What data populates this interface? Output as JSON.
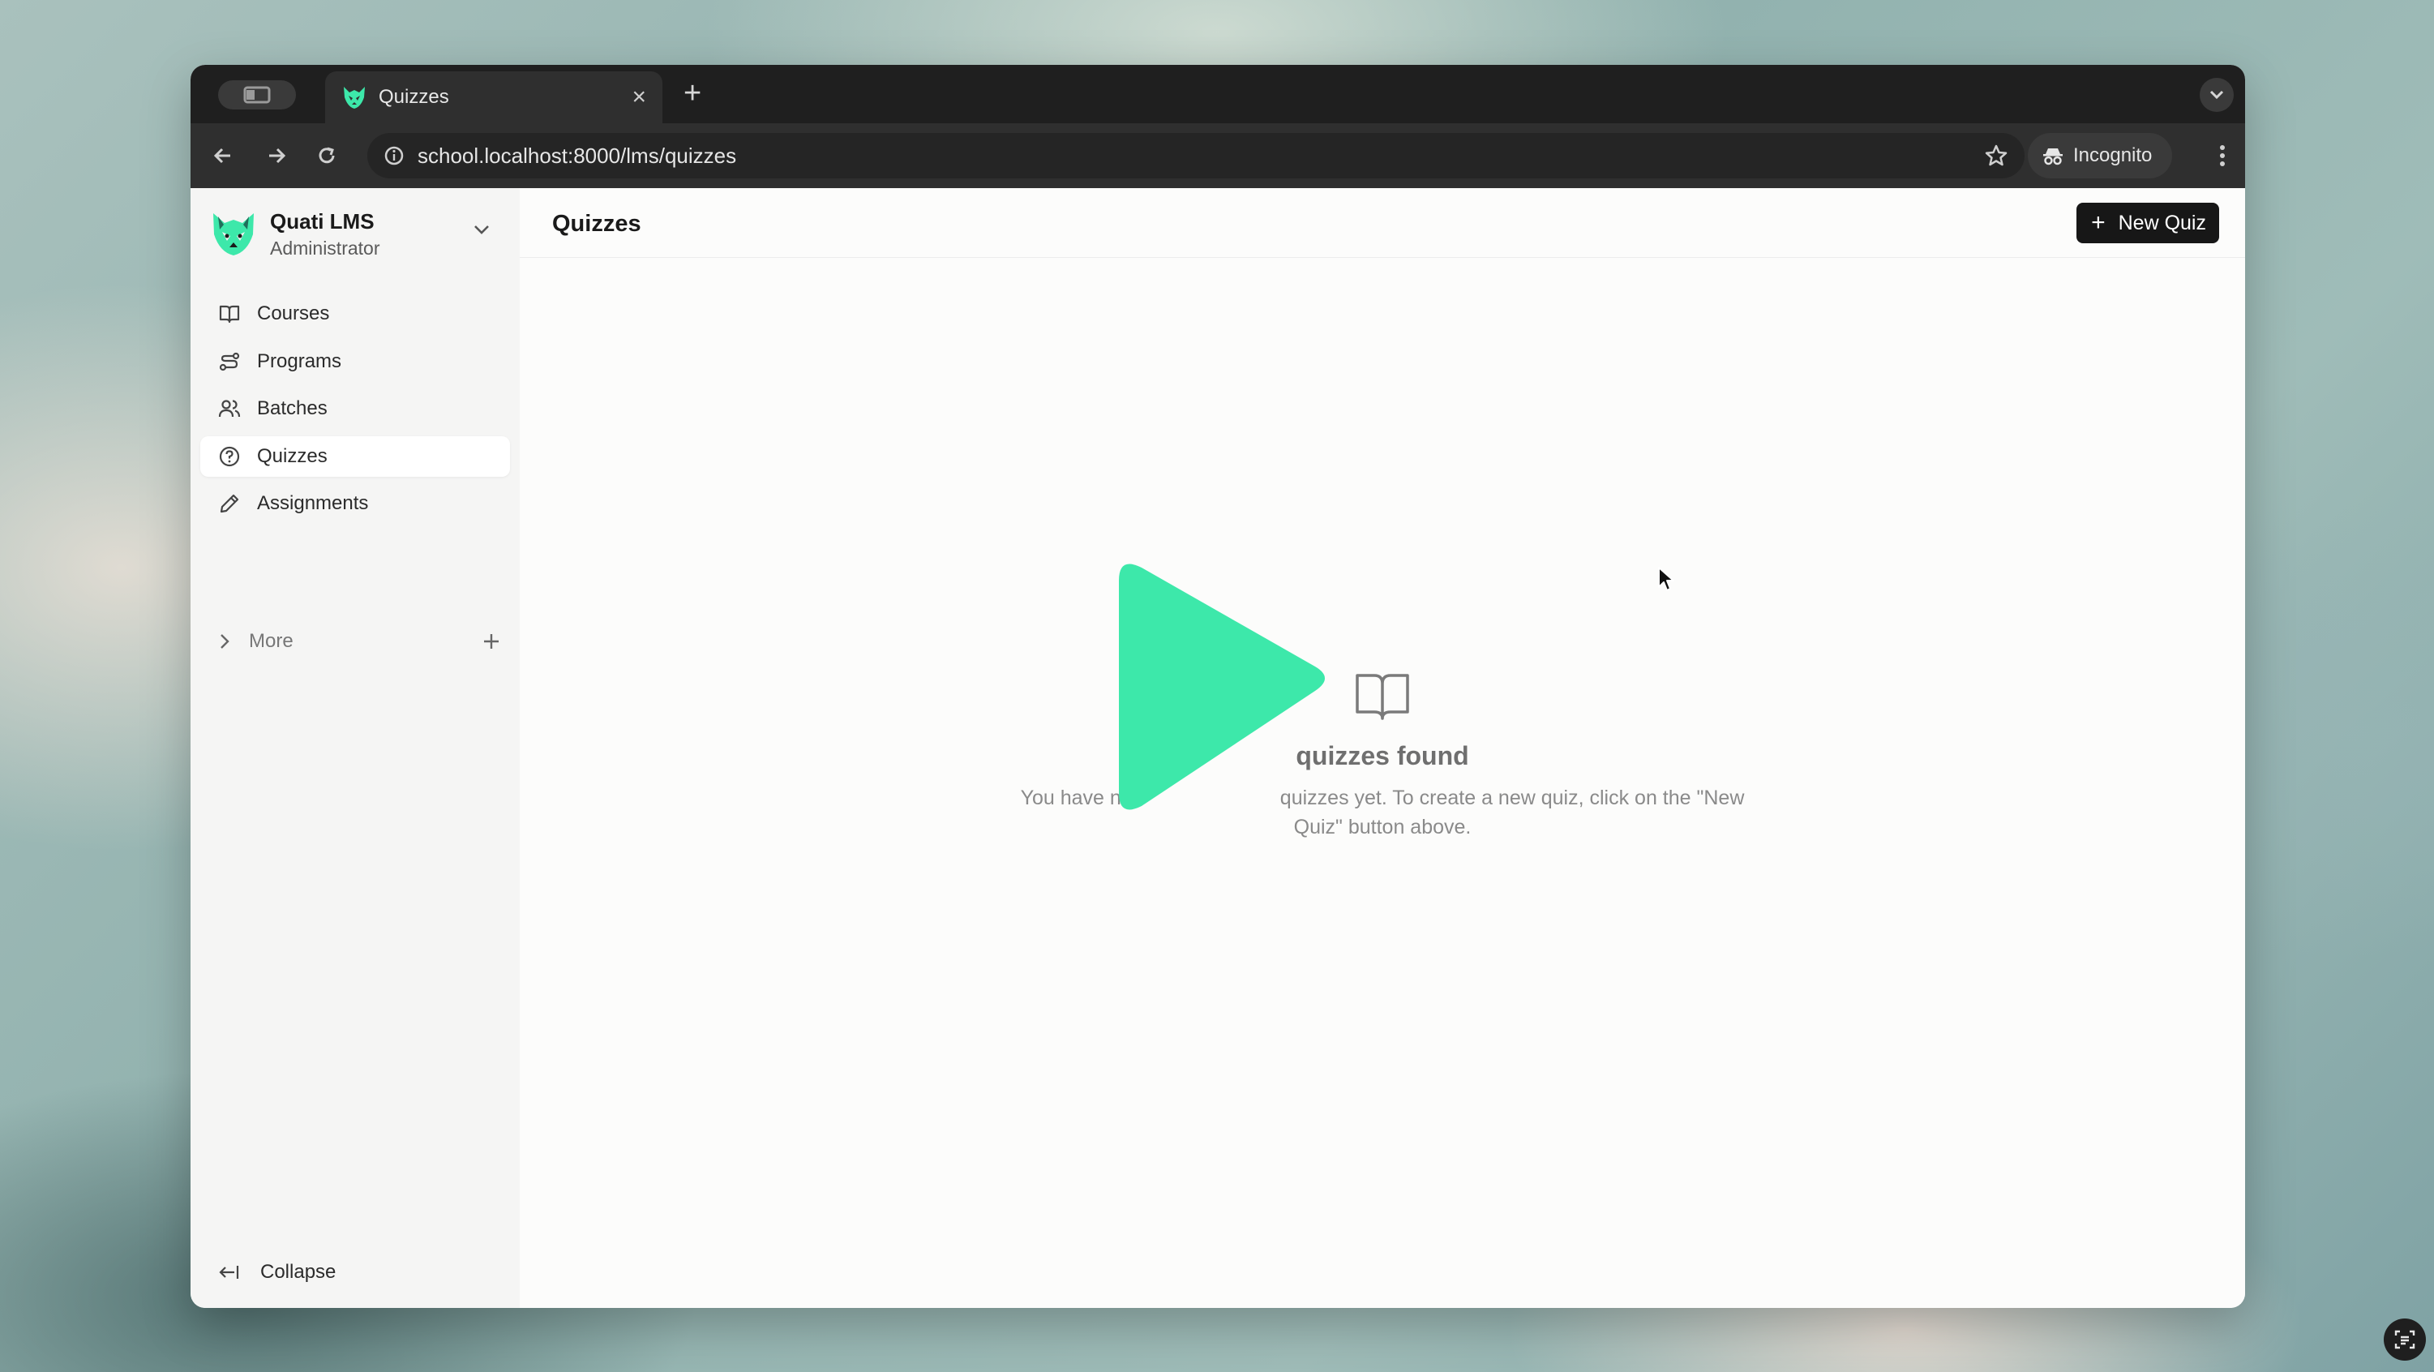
{
  "browser": {
    "tab_title": "Quizzes",
    "url": "school.localhost:8000/lms/quizzes",
    "incognito_label": "Incognito"
  },
  "sidebar": {
    "brand_name": "Quati LMS",
    "brand_role": "Administrator",
    "items": [
      {
        "label": "Courses",
        "icon": "book-open-icon"
      },
      {
        "label": "Programs",
        "icon": "route-icon"
      },
      {
        "label": "Batches",
        "icon": "users-icon"
      },
      {
        "label": "Quizzes",
        "icon": "help-circle-icon",
        "active": true
      },
      {
        "label": "Assignments",
        "icon": "pencil-icon"
      }
    ],
    "more_label": "More",
    "collapse_label": "Collapse"
  },
  "main": {
    "title": "Quizzes",
    "new_button_label": "New Quiz",
    "empty_title": "quizzes found",
    "empty_desc_left": "You have n",
    "empty_desc_right": "quizzes yet. To create a new quiz, click on the \"New Quiz\" button above."
  },
  "colors": {
    "brand_accent": "#3de8aa",
    "button_bg": "#171717",
    "sidebar_bg": "#f5f5f4"
  }
}
